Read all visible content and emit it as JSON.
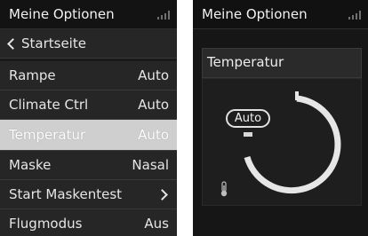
{
  "left_screen": {
    "header_title": "Meine Optionen",
    "menu": [
      {
        "label": "Startseite",
        "value": "",
        "type": "back"
      },
      {
        "label": "Rampe",
        "value": "Auto",
        "type": "item"
      },
      {
        "label": "Climate Ctrl",
        "value": "Auto",
        "type": "item"
      },
      {
        "label": "Temperatur",
        "value": "Auto",
        "type": "item",
        "selected": true
      },
      {
        "label": "Maske",
        "value": "Nasal",
        "type": "item"
      },
      {
        "label": "Start Maskentest",
        "value": "",
        "type": "submenu"
      },
      {
        "label": "Flugmodus",
        "value": "Aus",
        "type": "item"
      }
    ]
  },
  "right_screen": {
    "header_title": "Meine Optionen",
    "panel_title": "Temperatur",
    "setting_value": "Auto",
    "icon": "thermometer-icon"
  },
  "colors": {
    "background": "#1a1a1a",
    "highlight": "#cfcfcf",
    "text": "#e6e6e6"
  }
}
